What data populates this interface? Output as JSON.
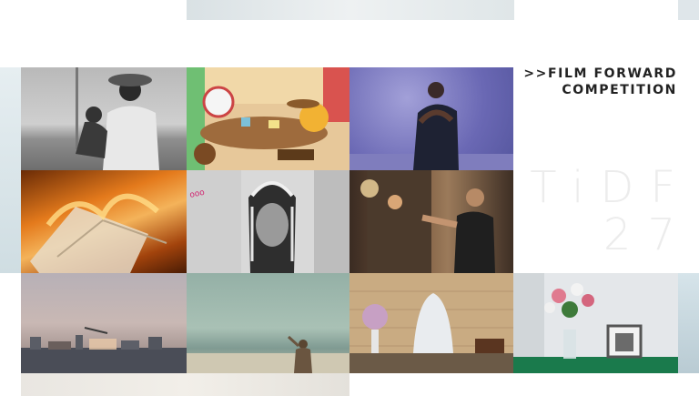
{
  "heading": {
    "line1": ">>FILM FORWARD",
    "line2": "COMPETITION"
  },
  "logo": {
    "line1": "TiDF",
    "line2": "27"
  },
  "colors": {
    "background": "#ffffff",
    "heading_text": "#222222",
    "logo_text": "#ececec"
  },
  "stills": [
    "man-in-hat-holding-baby",
    "cartoon-tea-party",
    "dancers-embracing-purple-light",
    "burning-papers",
    "headdress-portrait",
    "man-punching-mirror",
    "hazy-industrial-skyline",
    "person-on-shore",
    "veiled-figure-with-flowers",
    "flowers-and-picture-frame"
  ]
}
